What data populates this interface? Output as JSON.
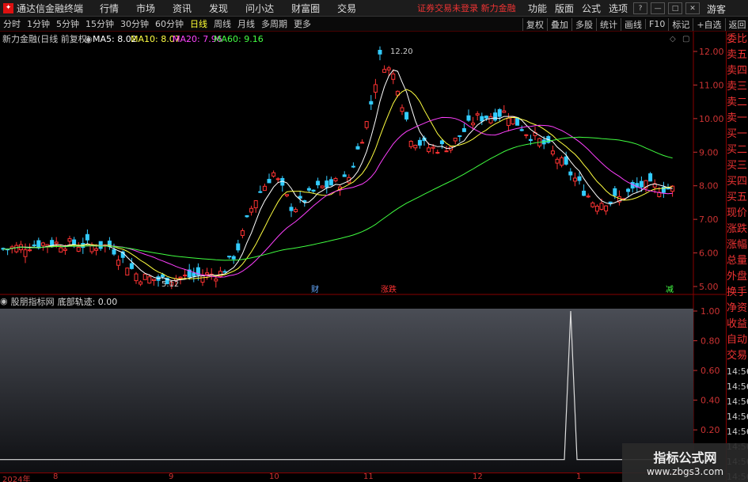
{
  "app": {
    "title": "通达信金融终端",
    "status": "证券交易未登录  新力金融",
    "guest": "游客"
  },
  "menu": [
    "行情",
    "市场",
    "资讯",
    "发现",
    "问小达",
    "财富圈",
    "交易"
  ],
  "right_menu": [
    "功能",
    "版面",
    "公式",
    "选项"
  ],
  "periods": [
    "分时",
    "1分钟",
    "5分钟",
    "15分钟",
    "30分钟",
    "60分钟",
    "日线",
    "周线",
    "月线",
    "多周期",
    "更多"
  ],
  "active_period": "日线",
  "tools": [
    "复权",
    "叠加",
    "多股",
    "统计",
    "画线",
    "F10",
    "标记",
    "+自选",
    "返回"
  ],
  "chart": {
    "stock": "新力金融(日线 前复权)",
    "ma": [
      {
        "label": "MA5: 8.02",
        "color": "#ffffff"
      },
      {
        "label": "MA10: 8.07",
        "color": "#ffff40"
      },
      {
        "label": "MA20: 7.96",
        "color": "#ff40ff"
      },
      {
        "label": "MA60: 9.16",
        "color": "#40ff40"
      }
    ],
    "high_label": "12.20",
    "low_label": "5.12",
    "y_ticks": [
      "12.00",
      "11.00",
      "10.00",
      "9.00",
      "8.00",
      "7.00",
      "6.00",
      "5.00"
    ],
    "events": [
      {
        "t": "财",
        "c": "#6af"
      },
      {
        "t": "涨跌",
        "c": "#f33"
      },
      {
        "t": "减",
        "c": "#4f4"
      }
    ]
  },
  "indicator": {
    "name": "股朋指标网",
    "line": "底部轨迹: 0.00",
    "y_ticks": [
      "1.00",
      "0.80",
      "0.60",
      "0.40",
      "0.20"
    ]
  },
  "dates": [
    "2024年",
    "8",
    "9",
    "10",
    "11",
    "12",
    "1"
  ],
  "side": {
    "items": [
      "委比",
      "卖五",
      "卖四",
      "卖三",
      "卖二",
      "卖一",
      "买一",
      "买二",
      "买三",
      "买四",
      "买五",
      "现价",
      "涨跌",
      "涨幅",
      "总量",
      "外盘",
      "换手",
      "净资",
      "收益",
      "自动",
      "交易"
    ],
    "times": [
      "14:56",
      "14:56",
      "14:56",
      "14:56",
      "14:56",
      "14:56",
      "14:56",
      "14:56",
      "14:56"
    ]
  },
  "watermark": {
    "line1": "指标公式网",
    "line2": "www.zbgs3.com"
  },
  "chart_data": {
    "type": "candlestick",
    "series": [
      {
        "name": "MA5",
        "last": 8.02
      },
      {
        "name": "MA10",
        "last": 8.07
      },
      {
        "name": "MA20",
        "last": 7.96
      },
      {
        "name": "MA60",
        "last": 9.16
      }
    ],
    "ylim": [
      5.0,
      12.2
    ],
    "high": 12.2,
    "low": 5.12
  }
}
